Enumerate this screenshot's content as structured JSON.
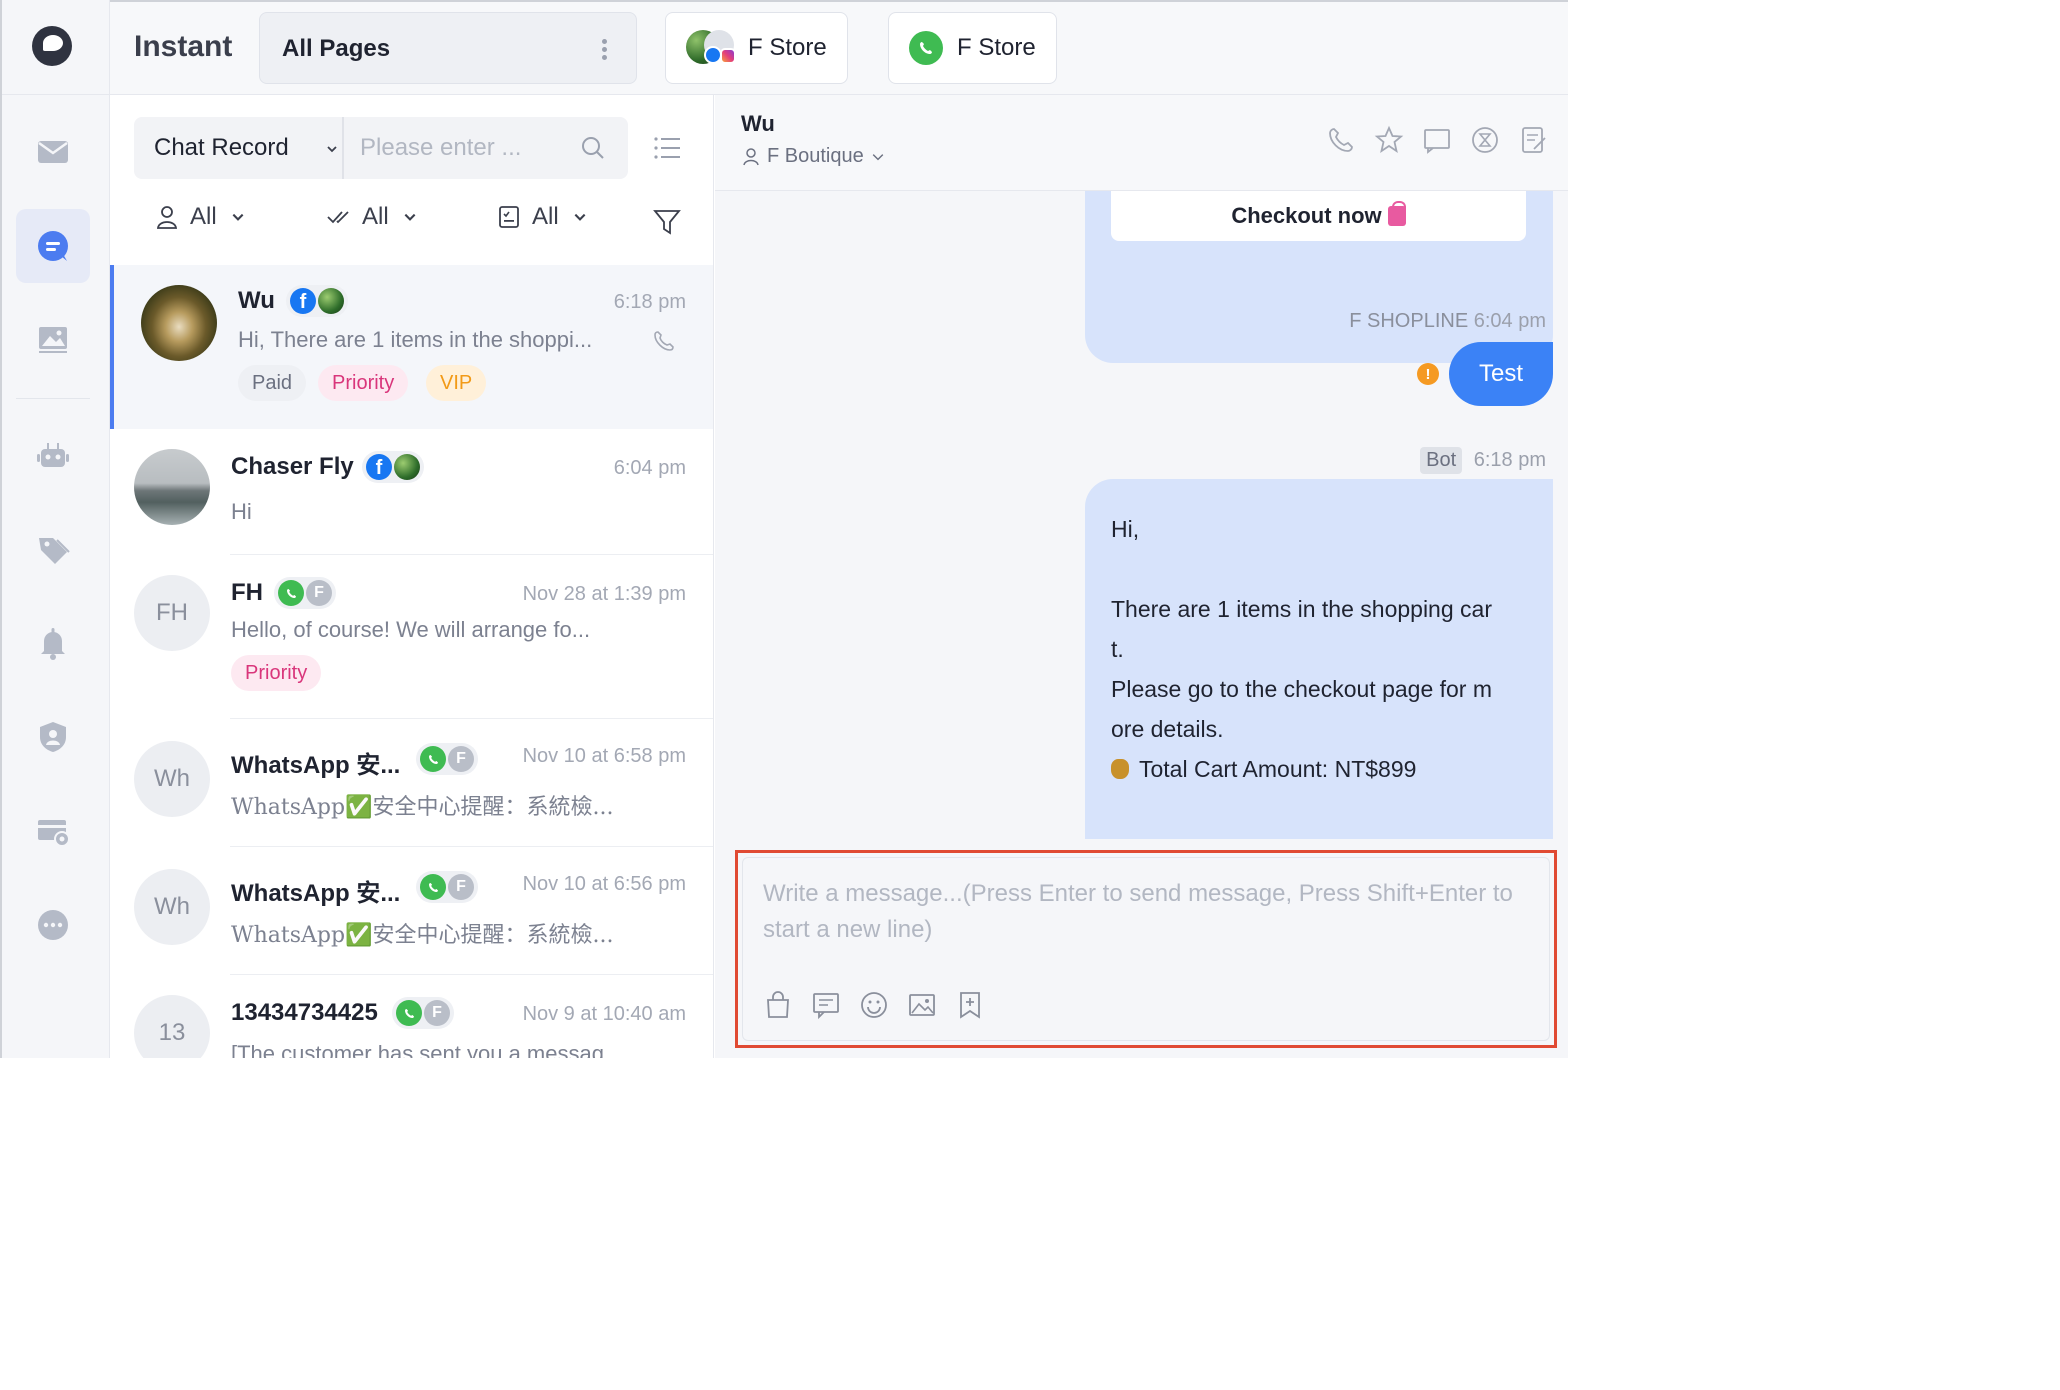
{
  "app": {
    "title": "Instant"
  },
  "topbar": {
    "pages_label": "All Pages",
    "store_tabs": [
      {
        "name": "F Store",
        "icon": "facebook-instagram-page-avatar"
      },
      {
        "name": "F Store",
        "icon": "whatsapp-icon"
      }
    ]
  },
  "sidebar": {
    "items": [
      {
        "icon": "mail-icon",
        "active": false
      },
      {
        "icon": "chat-bubble-icon",
        "active": true
      },
      {
        "icon": "image-gallery-icon",
        "active": false
      },
      {
        "icon": "robot-icon",
        "active": false
      },
      {
        "icon": "tag-icon",
        "active": false
      },
      {
        "icon": "bell-icon",
        "active": false
      },
      {
        "icon": "user-shield-icon",
        "active": false
      },
      {
        "icon": "card-settings-icon",
        "active": false
      },
      {
        "icon": "more-icon",
        "active": false
      }
    ]
  },
  "list": {
    "mode_label": "Chat Record",
    "search_placeholder": "Please enter ...",
    "filters": [
      {
        "label": "All",
        "icon": "user-icon"
      },
      {
        "label": "All",
        "icon": "double-check-icon"
      },
      {
        "label": "All",
        "icon": "checklist-icon"
      }
    ],
    "conversations": [
      {
        "name": "Wu",
        "time": "6:18 pm",
        "preview": "Hi,  There are 1 items in the shoppi...",
        "tags": [
          "Paid",
          "Priority",
          "VIP"
        ],
        "channels": [
          "facebook",
          "page-avatar"
        ]
      },
      {
        "name": "Chaser Fly",
        "time": "6:04 pm",
        "preview": "Hi",
        "tags": [],
        "channels": [
          "facebook",
          "page-avatar"
        ]
      },
      {
        "name": "FH",
        "avatar_text": "FH",
        "time": "Nov 28 at 1:39 pm",
        "preview": "Hello, of course! We will arrange fo...",
        "tags": [
          "Priority"
        ],
        "channels": [
          "whatsapp",
          "f-store"
        ]
      },
      {
        "name": "WhatsApp 安...",
        "avatar_text": "Wh",
        "time": "Nov 10 at 6:58 pm",
        "preview": "WhatsApp✅安全中心提醒：系統檢...",
        "tags": [],
        "channels": [
          "whatsapp",
          "f-store"
        ]
      },
      {
        "name": "WhatsApp 安...",
        "avatar_text": "Wh",
        "time": "Nov 10 at 6:56 pm",
        "preview": "WhatsApp✅安全中心提醒：系統檢...",
        "tags": [],
        "channels": [
          "whatsapp",
          "f-store"
        ]
      },
      {
        "name": "13434734425",
        "avatar_text": "13",
        "time": "Nov 9 at 10:40 am",
        "preview": "[The customer has sent you a messag...",
        "tags": [],
        "channels": [
          "whatsapp",
          "f-store"
        ]
      }
    ],
    "channel_letter": "F"
  },
  "chat": {
    "title": "Wu",
    "assignee": "F Boutique",
    "checkout_label": "Checkout now",
    "messages": [
      {
        "sender": "F SHOPLINE",
        "time": "6:04 pm",
        "text": "Test",
        "status": "warning"
      },
      {
        "sender_badge": "Bot",
        "time": "6:18 pm",
        "lines": [
          "Hi,",
          "There are 1 items in the shopping car",
          "t.",
          "Please go to the checkout page for m",
          "ore details.",
          "Total Cart Amount: NT$899"
        ]
      }
    ],
    "warning_mark": "!",
    "composer_placeholder": "Write a message...(Press Enter to send message, Press Shift+Enter to start a new line)"
  },
  "colors": {
    "accent": "#4c7cf0",
    "bubble_out": "#3b82f6",
    "bubble_bot": "#d7e3fb",
    "priority": "#d9367b",
    "vip": "#f29a17",
    "highlight": "#e04a33"
  }
}
